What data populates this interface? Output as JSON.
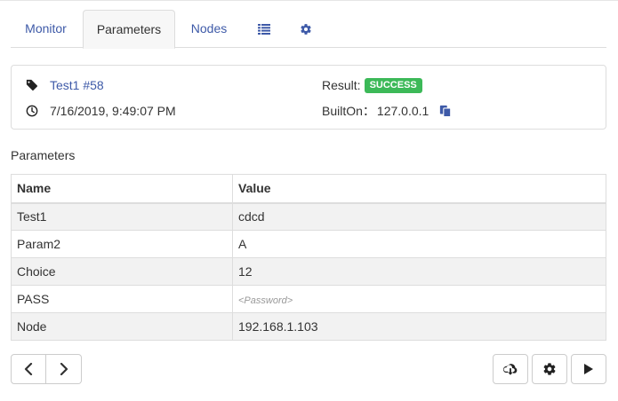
{
  "tabs": [
    {
      "label": "Monitor"
    },
    {
      "label": "Parameters"
    },
    {
      "label": "Nodes"
    }
  ],
  "tab_icons": [
    "list-icon",
    "gear-icon"
  ],
  "build": {
    "name": "Test1 #58",
    "timestamp": "7/16/2019, 9:49:07 PM",
    "result_label": "Result:",
    "result_status": "SUCCESS",
    "built_on_label": "BuiltOn：",
    "built_on_value": "127.0.0.1"
  },
  "parameters": {
    "section_title": "Parameters",
    "headers": {
      "name": "Name",
      "value": "Value"
    },
    "rows": [
      {
        "name": "Test1",
        "value": "cdcd"
      },
      {
        "name": "Param2",
        "value": "A"
      },
      {
        "name": "Choice",
        "value": "12"
      },
      {
        "name": "PASS",
        "value": "<Password>"
      },
      {
        "name": "Node",
        "value": "192.168.1.103"
      }
    ]
  },
  "colors": {
    "link": "#3e5aa8",
    "success": "#3cb958",
    "border": "#dddddd",
    "row_stripe": "#f2f2f2"
  }
}
